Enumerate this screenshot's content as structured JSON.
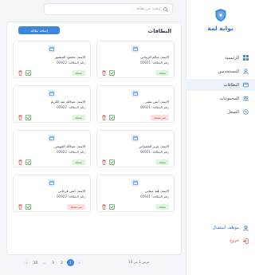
{
  "app": {
    "title": "بوابة لمة"
  },
  "search": {
    "placeholder": "ابحث عن بطاقة ..."
  },
  "sidebar": {
    "items": [
      {
        "label": "الرئيسية",
        "icon": "grid-icon"
      },
      {
        "label": "المستخدمين",
        "icon": "users-icon"
      },
      {
        "label": "البطاقات",
        "icon": "card-icon"
      },
      {
        "label": "المجموعات",
        "icon": "groups-icon"
      },
      {
        "label": "السجل",
        "icon": "history-icon"
      }
    ],
    "active_index": 2,
    "user_label": "موظف استقبال",
    "logout_label": "خروج"
  },
  "main": {
    "title": "البطاقات",
    "add_button": "إضافة بطاقة"
  },
  "cards": [
    {
      "name": "الاسم: سالم الزيداني",
      "number": "رقم البطاقة: 00921",
      "status": "مفعلة",
      "status_type": "ok"
    },
    {
      "name": "الاسم: محمود المنصور",
      "number": "رقم البطاقة: 00922",
      "status": "مفعلة",
      "status_type": "ok"
    },
    {
      "name": "الاسم: أيمن بشير",
      "number": "رقم البطاقة: 00921",
      "status": "غير مفعلة",
      "status_type": "bad"
    },
    {
      "name": "الاسم: عبدالله عبد الكريم",
      "number": "رقم البطاقة: 00922",
      "status": "مفعلة",
      "status_type": "ok"
    },
    {
      "name": "الاسم: عزيز المصراتي",
      "number": "رقم البطاقة: 00921",
      "status": "مفعلة",
      "status_type": "ok"
    },
    {
      "name": "الاسم: عبدالله القويمي",
      "number": "رقم البطاقة: 00922",
      "status": "مفعلة",
      "status_type": "ok"
    },
    {
      "name": "الاسم: هند عيتاني",
      "number": "رقم البطاقة: 00921",
      "status": "مفعلة",
      "status_type": "ok"
    },
    {
      "name": "الاسم: أنفي فرجاني",
      "number": "رقم البطاقة: 00922",
      "status": "غير مفعلة",
      "status_type": "bad"
    }
  ],
  "pagination": {
    "pages": [
      "1",
      "2",
      "3",
      "...",
      "10"
    ],
    "current": "1",
    "info": "عرض 1 من 10"
  },
  "colors": {
    "accent": "#3d86e0",
    "success": "#3a9a3a",
    "danger": "#d24a4a"
  }
}
